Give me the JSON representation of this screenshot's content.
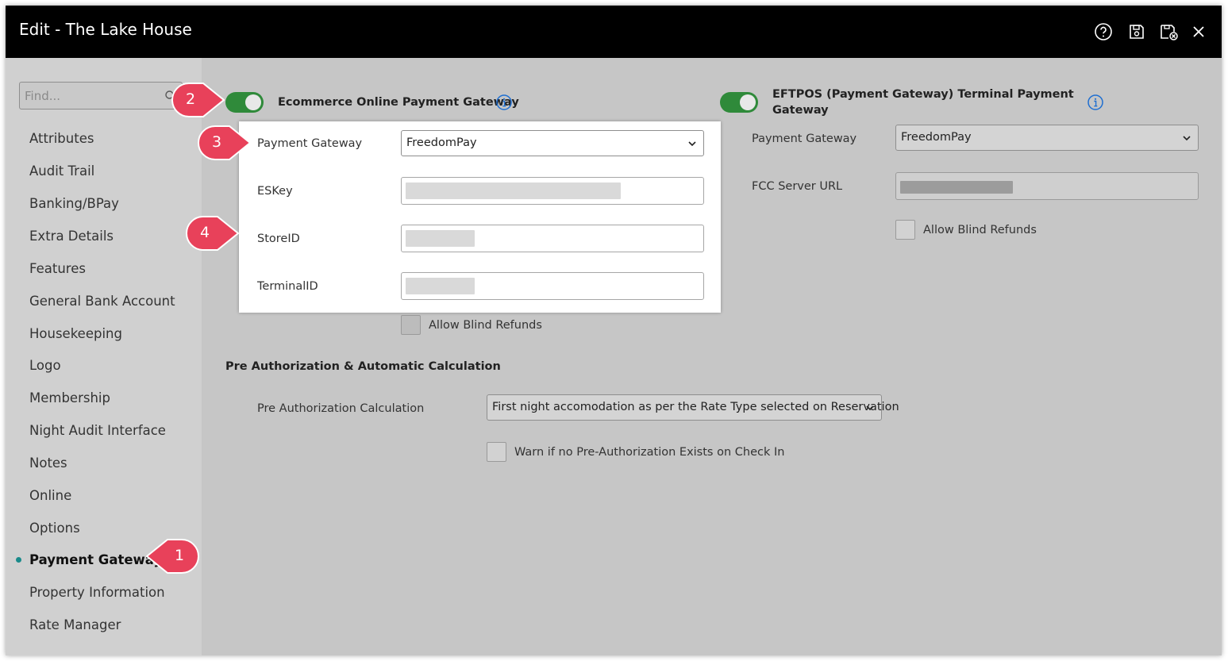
{
  "window": {
    "title": "Edit - The Lake House"
  },
  "toolbar": {
    "icons": [
      "help-icon",
      "save-icon",
      "save-and-close-icon",
      "close-icon"
    ]
  },
  "sidebar": {
    "search": {
      "placeholder": "Find..."
    },
    "items": [
      {
        "label": "Attributes"
      },
      {
        "label": "Audit Trail"
      },
      {
        "label": "Banking/BPay"
      },
      {
        "label": "Extra Details"
      },
      {
        "label": "Features"
      },
      {
        "label": "General Bank Account"
      },
      {
        "label": "Housekeeping"
      },
      {
        "label": "Logo"
      },
      {
        "label": "Membership"
      },
      {
        "label": "Night Audit Interface"
      },
      {
        "label": "Notes"
      },
      {
        "label": "Online"
      },
      {
        "label": "Options"
      },
      {
        "label": "Payment Gateway",
        "active": true
      },
      {
        "label": "Property Information"
      },
      {
        "label": "Rate Manager"
      }
    ]
  },
  "ecommerce": {
    "title": "Ecommerce Online Payment Gateway",
    "enabled": true,
    "payment_gateway_label": "Payment Gateway",
    "payment_gateway_value": "FreedomPay",
    "eskey_label": "ESKey",
    "storeid_label": "StoreID",
    "terminalid_label": "TerminalID",
    "allow_blind_refunds_label": "Allow Blind Refunds"
  },
  "eftpos": {
    "title_line1": "EFTPOS (Payment Gateway) Terminal Payment",
    "title_line2": "Gateway",
    "enabled": true,
    "payment_gateway_label": "Payment Gateway",
    "payment_gateway_value": "FreedomPay",
    "fcc_label": "FCC Server URL",
    "allow_blind_refunds_label": "Allow Blind Refunds"
  },
  "preauth": {
    "section_title": "Pre Authorization & Automatic Calculation",
    "calc_label": "Pre Authorization Calculation",
    "calc_value": "First night accomodation as per the Rate Type selected on Reservation",
    "warn_label": "Warn if no Pre-Authorization Exists on Check In"
  },
  "callouts": [
    "1",
    "2",
    "3",
    "4"
  ],
  "colors": {
    "titlebar": "#000000",
    "background": "#c6c6c6",
    "toggle_on": "#2f8a3a",
    "callout": "#e8415a",
    "info": "#1f6fd1",
    "active_dot": "#1a8a8a"
  }
}
